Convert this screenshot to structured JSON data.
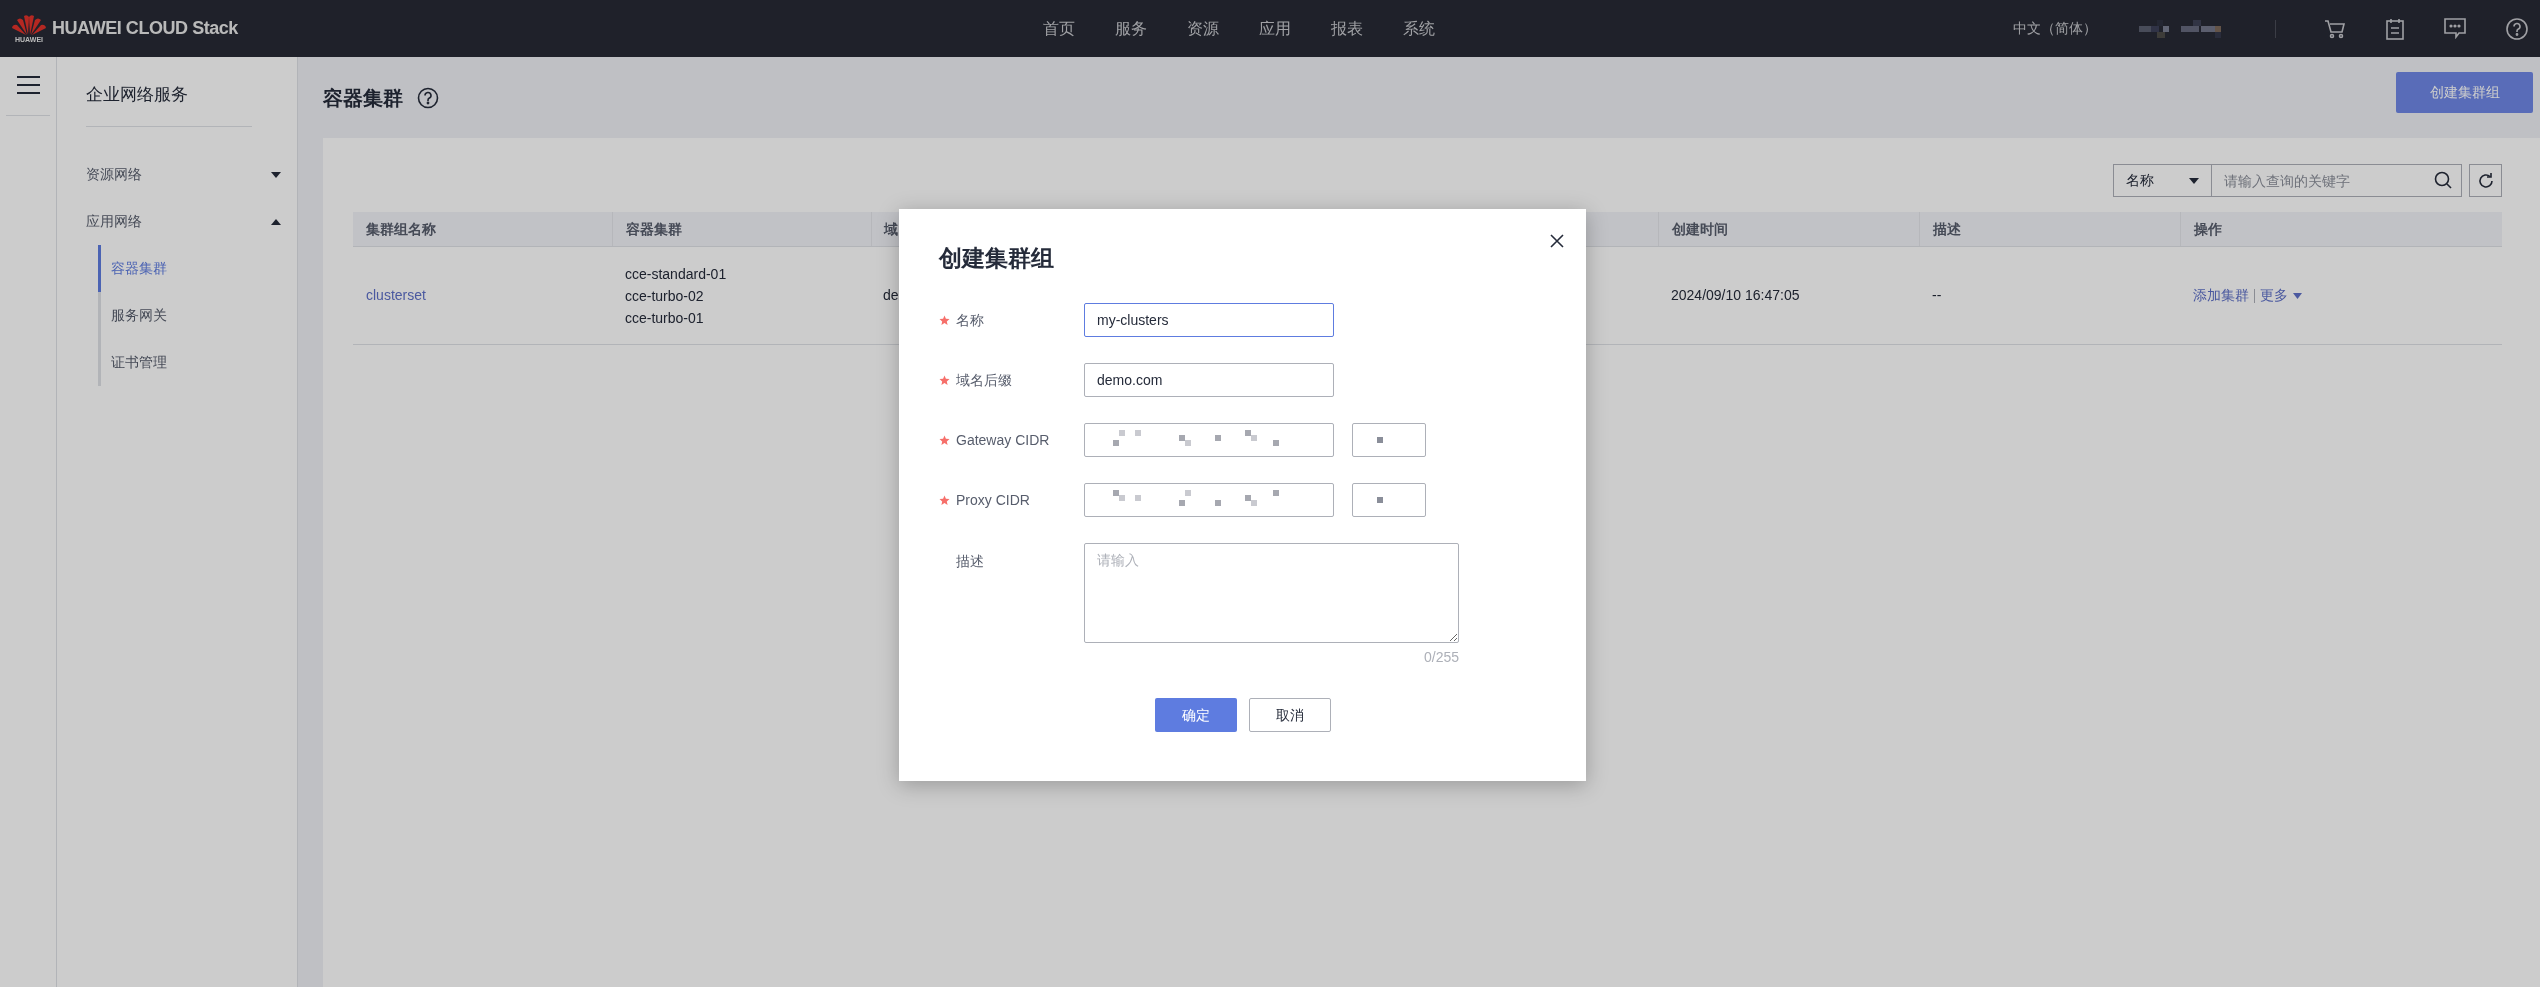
{
  "top_bar": {
    "logo_text": "HUAWEI",
    "brand": "HUAWEI CLOUD Stack",
    "nav": [
      {
        "label": "首页"
      },
      {
        "label": "服务"
      },
      {
        "label": "资源"
      },
      {
        "label": "应用"
      },
      {
        "label": "报表"
      },
      {
        "label": "系统"
      }
    ],
    "language": "中文（简体）"
  },
  "sidebar": {
    "title": "企业网络服务",
    "groups": [
      {
        "label": "资源网络",
        "expanded": false
      },
      {
        "label": "应用网络",
        "expanded": true,
        "children": [
          {
            "label": "容器集群",
            "selected": true
          },
          {
            "label": "服务网关",
            "selected": false
          },
          {
            "label": "证书管理",
            "selected": false
          }
        ]
      }
    ]
  },
  "page": {
    "title": "容器集群",
    "create_button": "创建集群组"
  },
  "search": {
    "field": "名称",
    "placeholder": "请输入查询的关键字"
  },
  "table": {
    "columns": [
      "集群组名称",
      "容器集群",
      "域",
      "创建时间",
      "描述",
      "操作"
    ],
    "rows": [
      {
        "name": "clusterset",
        "clusters": [
          "cce-standard-01",
          "cce-turbo-02",
          "cce-turbo-01"
        ],
        "column_3": "de",
        "created": "2024/09/10 16:47:05",
        "description": "--",
        "actions": [
          "添加集群",
          "更多"
        ]
      }
    ]
  },
  "dialog": {
    "title": "创建集群组",
    "fields": [
      {
        "label": "名称",
        "required": true,
        "kind": "text",
        "value": "my-clusters",
        "focused": true
      },
      {
        "label": "域名后缀",
        "required": true,
        "kind": "text",
        "value": "demo.com",
        "focused": false
      },
      {
        "label": "Gateway CIDR",
        "required": true,
        "kind": "cidr"
      },
      {
        "label": "Proxy CIDR",
        "required": true,
        "kind": "cidr"
      },
      {
        "label": "描述",
        "required": false,
        "kind": "textarea",
        "placeholder": "请输入",
        "counter": "0/255"
      }
    ],
    "buttons": [
      {
        "label": "确定",
        "primary": true
      },
      {
        "label": "取消",
        "primary": false
      }
    ]
  }
}
